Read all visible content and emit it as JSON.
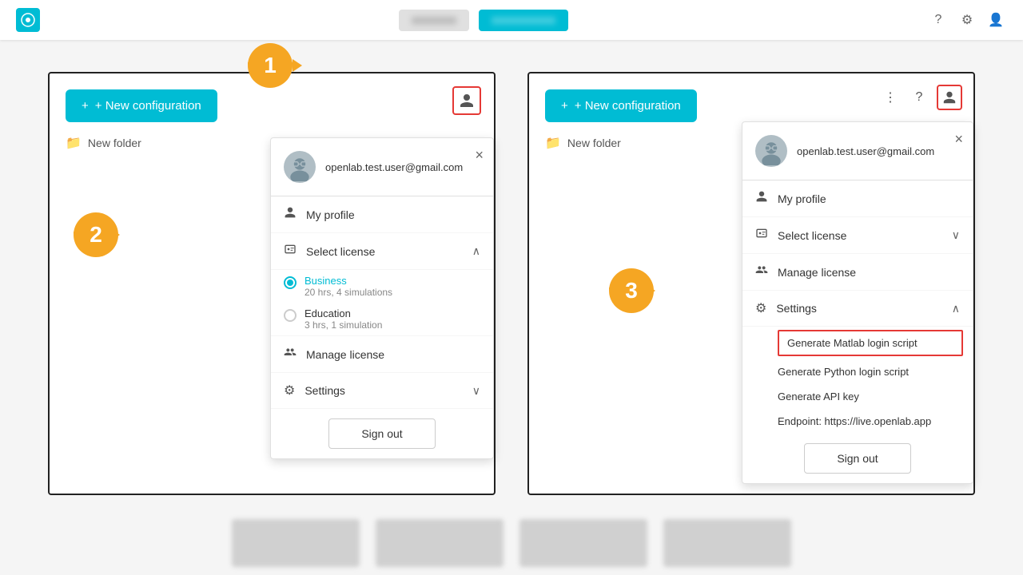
{
  "topbar": {
    "logo_text": "O",
    "btn1_label": "XXXXXXX",
    "btn2_label": "XXXXXXX",
    "active_btn_label": "XXXXXXXXXX"
  },
  "left_panel": {
    "new_config_label": "+ New configuration",
    "new_folder_label": "New folder",
    "profile_icon_label": "👤",
    "step1_label": "1",
    "step2_label": "2",
    "dropdown": {
      "user_email": "openlab.test.user@gmail.com",
      "menu_items": [
        {
          "id": "my-profile",
          "label": "My profile",
          "icon": "👤"
        },
        {
          "id": "select-license",
          "label": "Select license",
          "icon": "🪪",
          "expandable": true,
          "expanded": true
        },
        {
          "id": "manage-license",
          "label": "Manage license",
          "icon": "👥"
        },
        {
          "id": "settings",
          "label": "Settings",
          "icon": "⚙️",
          "expandable": true,
          "expanded": false
        }
      ],
      "licenses": [
        {
          "id": "business",
          "name": "Business",
          "detail": "20 hrs, 4 simulations",
          "selected": true
        },
        {
          "id": "education",
          "name": "Education",
          "detail": "3 hrs, 1 simulation",
          "selected": false
        }
      ],
      "sign_out_label": "Sign out"
    }
  },
  "right_panel": {
    "new_config_label": "+ New configuration",
    "new_folder_label": "New folder",
    "step3_label": "3",
    "dropdown": {
      "user_email": "openlab.test.user@gmail.com",
      "menu_items": [
        {
          "id": "my-profile",
          "label": "My profile",
          "icon": "👤"
        },
        {
          "id": "select-license",
          "label": "Select license",
          "icon": "🪪",
          "expandable": true,
          "expanded": false
        },
        {
          "id": "manage-license",
          "label": "Manage license",
          "icon": "👥"
        },
        {
          "id": "settings",
          "label": "Settings",
          "icon": "⚙️",
          "expandable": true,
          "expanded": true
        }
      ],
      "settings_items": [
        {
          "id": "matlab",
          "label": "Generate Matlab login script",
          "highlighted": true
        },
        {
          "id": "python",
          "label": "Generate Python login script",
          "highlighted": false
        },
        {
          "id": "api",
          "label": "Generate API key",
          "highlighted": false
        },
        {
          "id": "endpoint",
          "label": "Endpoint: https://live.openlab.app",
          "highlighted": false
        }
      ],
      "sign_out_label": "Sign out"
    }
  }
}
